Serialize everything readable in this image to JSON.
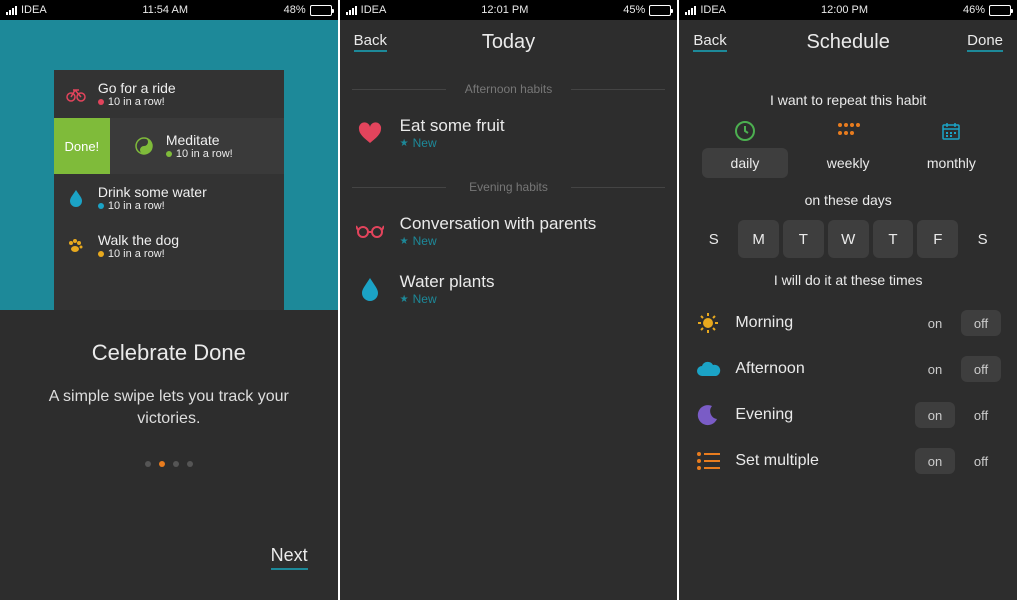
{
  "screen1": {
    "status": {
      "carrier": "IDEA",
      "time": "11:54 AM",
      "battery": "48%"
    },
    "habits": [
      {
        "title": "Go for a ride",
        "sub": "10 in a row!",
        "color": "#e2445c",
        "icon": "bike"
      },
      {
        "title": "Meditate",
        "sub": "10 in a row!",
        "color": "#7fbb3a",
        "icon": "yinyang",
        "done": "Done!"
      },
      {
        "title": "Drink some water",
        "sub": "10 in a row!",
        "color": "#1ba3c6",
        "icon": "drop"
      },
      {
        "title": "Walk the dog",
        "sub": "10 in a row!",
        "color": "#e8a91e",
        "icon": "paw"
      }
    ],
    "heading": "Celebrate Done",
    "body": "A simple swipe lets you track your victories.",
    "next": "Next"
  },
  "screen2": {
    "status": {
      "carrier": "IDEA",
      "time": "12:01 PM",
      "battery": "45%"
    },
    "back": "Back",
    "title": "Today",
    "sections": {
      "afternoon": "Afternoon habits",
      "evening": "Evening habits"
    },
    "items": [
      {
        "title": "Eat some fruit",
        "sub": "New",
        "icon": "heart",
        "color": "#e2445c"
      },
      {
        "title": "Conversation with parents",
        "sub": "New",
        "icon": "glasses",
        "color": "#e2445c"
      },
      {
        "title": "Water plants",
        "sub": "New",
        "icon": "drop",
        "color": "#1ba3c6"
      }
    ]
  },
  "screen3": {
    "status": {
      "carrier": "IDEA",
      "time": "12:00 PM",
      "battery": "46%"
    },
    "back": "Back",
    "title": "Schedule",
    "done": "Done",
    "labels": {
      "repeat": "I want to repeat this habit",
      "days": "on these days",
      "times": "I will do it at these times"
    },
    "freq": [
      {
        "label": "daily",
        "active": true,
        "color": "#4caf50"
      },
      {
        "label": "weekly",
        "active": false,
        "color": "#e87c1e"
      },
      {
        "label": "monthly",
        "active": false,
        "color": "#1ba3c6"
      }
    ],
    "days": [
      {
        "l": "S",
        "sel": false
      },
      {
        "l": "M",
        "sel": true
      },
      {
        "l": "T",
        "sel": true
      },
      {
        "l": "W",
        "sel": true
      },
      {
        "l": "T",
        "sel": true
      },
      {
        "l": "F",
        "sel": true
      },
      {
        "l": "S",
        "sel": false
      }
    ],
    "times": [
      {
        "label": "Morning",
        "icon": "sun",
        "color": "#e8a91e",
        "on": false
      },
      {
        "label": "Afternoon",
        "icon": "cloud",
        "color": "#1ba3c6",
        "on": false
      },
      {
        "label": "Evening",
        "icon": "moon",
        "color": "#7a5cc6",
        "on": true
      },
      {
        "label": "Set multiple",
        "icon": "list",
        "color": "#e87c1e",
        "on": true
      }
    ],
    "toggle": {
      "on": "on",
      "off": "off"
    }
  }
}
